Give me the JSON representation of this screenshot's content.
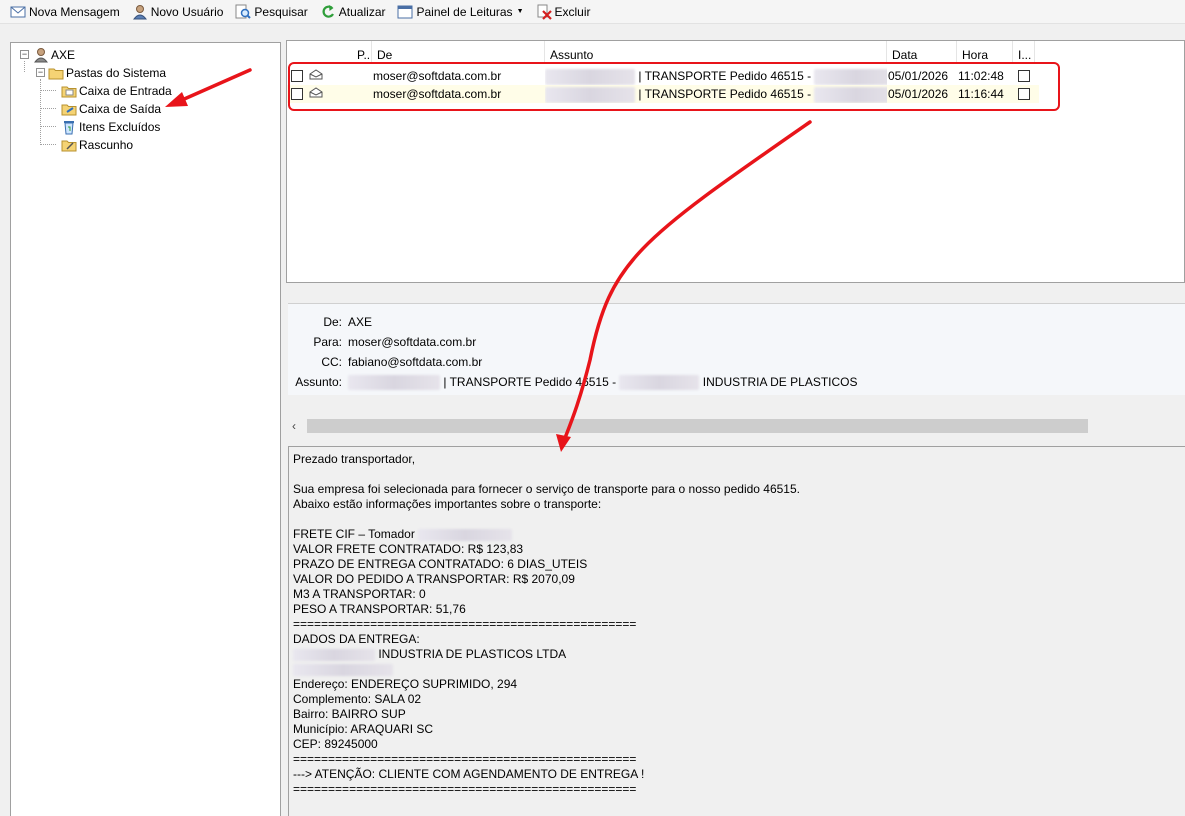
{
  "toolbar": {
    "nova_mensagem": "Nova Mensagem",
    "novo_usuario": "Novo Usuário",
    "pesquisar": "Pesquisar",
    "atualizar": "Atualizar",
    "painel_leituras": "Painel de Leituras",
    "excluir": "Excluir"
  },
  "tree": {
    "root": "AXE",
    "folder_group": "Pastas do Sistema",
    "items": [
      "Caixa de Entrada",
      "Caixa de Saída",
      "Itens Excluídos",
      "Rascunho"
    ],
    "selected": "Caixa de Saída"
  },
  "list": {
    "columns": [
      "P..",
      "De",
      "Assunto",
      "Data",
      "Hora",
      "I..."
    ],
    "rows": [
      {
        "from": "moser@softdata.com.br",
        "subject": "| TRANSPORTE Pedido 46515 -",
        "date": "05/01/2026",
        "time": "11:02:48"
      },
      {
        "from": "moser@softdata.com.br",
        "subject": "| TRANSPORTE Pedido 46515 -",
        "date": "05/01/2026",
        "time": "11:16:44"
      }
    ]
  },
  "header": {
    "de_label": "De:",
    "de_value": "AXE",
    "para_label": "Para:",
    "para_value": "moser@softdata.com.br",
    "cc_label": "CC:",
    "cc_value": "fabiano@softdata.com.br",
    "assunto_label": "Assunto:",
    "assunto_value_a": "| TRANSPORTE Pedido 46515 -",
    "assunto_value_b": "INDUSTRIA DE PLASTICOS"
  },
  "body": {
    "lines": [
      "Prezado transportador,",
      "",
      "Sua empresa foi selecionada para fornecer o serviço de transporte para o nosso pedido 46515.",
      "Abaixo estão informações importantes sobre o transporte:",
      "",
      "FRETE CIF – Tomador",
      "VALOR FRETE CONTRATADO: R$ 123,83",
      "PRAZO DE ENTREGA CONTRATADO: 6 DIAS_UTEIS",
      "VALOR DO PEDIDO A TRANSPORTAR: R$ 2070,09",
      "M3 A TRANSPORTAR: 0",
      "PESO A TRANSPORTAR: 51,76",
      "=================================================",
      "DADOS DA ENTREGA:",
      "INDUSTRIA DE PLASTICOS LTDA",
      "",
      "Endereço: ENDEREÇO SUPRIMIDO, 294",
      "Complemento: SALA 02",
      "Bairro: BAIRRO SUP",
      "Município: ARAQUARI SC",
      "CEP: 89245000",
      "=================================================",
      "---> ATENÇÃO: CLIENTE COM AGENDAMENTO DE ENTREGA !",
      "================================================="
    ]
  },
  "colors": {
    "annotation": "#e8141a",
    "row_highlight": "#fffde8"
  }
}
